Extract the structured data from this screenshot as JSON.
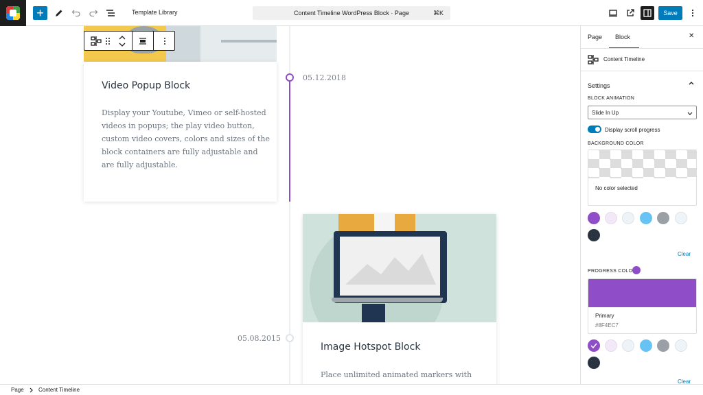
{
  "topbar": {
    "template_library": "Template Library",
    "command_title": "Content Timeline WordPress Block · Page",
    "command_shortcut": "⌘K",
    "save_label": "Save",
    "add_symbol": "+"
  },
  "block_toolbar": {
    "block_icon": "timeline-icon",
    "drag_icon": "drag-handle-icon",
    "move_icon": "move-up-down-icon",
    "align_icon": "align-icon",
    "more_icon": "more-vertical-icon"
  },
  "canvas": {
    "timeline_color": "#8F4EC7",
    "items": [
      {
        "title": "Video Popup Block",
        "description_lines": [
          "Display your Youtube, Vimeo or self-hosted",
          "videos in popups; the play video button,",
          "custom video covers, colors and sizes of the",
          "block containers are fully adjustable and",
          "are fully adjustable."
        ],
        "date": "05.12.2018"
      },
      {
        "title": "Image Hotspot Block",
        "description_lines": [
          "Place unlimited animated markers with"
        ],
        "date": "05.08.2015"
      }
    ]
  },
  "sidebar": {
    "tabs": [
      "Page",
      "Block"
    ],
    "active_tab": "Block",
    "close_symbol": "✕",
    "block_name": "Content Timeline",
    "settings_title": "Settings",
    "block_animation_label": "Block Animation",
    "block_animation_value": "Slide In Up",
    "scroll_progress_label": "Display scroll progress",
    "background_color_label": "Background Color",
    "no_color_text": "No color selected",
    "clear_label": "Clear",
    "progress_color_label": "Progress Color",
    "progress_color_name": "Primary",
    "progress_color_hex": "#8F4EC7",
    "palette": [
      "#8F4EC7",
      "#F3E8F8",
      "#EEF3F7",
      "#67C3F3",
      "#9AA0A6",
      "#EFF4F8",
      "#2A3440"
    ],
    "clear_label_2": "Clear"
  },
  "statusbar": {
    "breadcrumb": [
      "Page",
      "Content Timeline"
    ]
  }
}
